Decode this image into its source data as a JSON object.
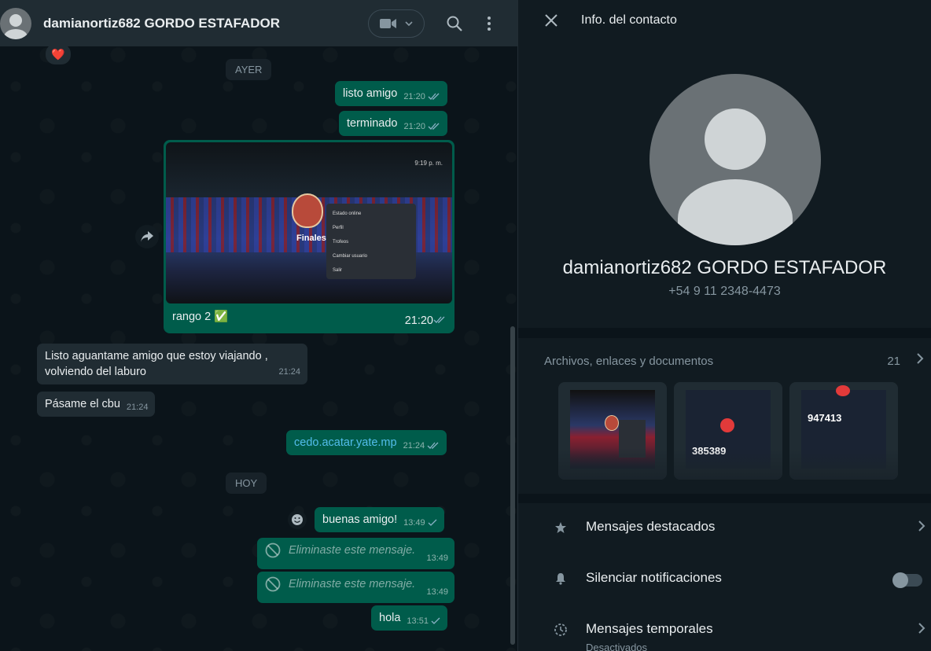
{
  "chat": {
    "title": "damianortiz682 GORDO ESTAFADOR",
    "reaction": "❤️",
    "day_yesterday": "AYER",
    "day_today": "HOY",
    "messages": [
      {
        "text": "listo amigo",
        "time": "21:20"
      },
      {
        "text": "terminado",
        "time": "21:20"
      },
      {
        "text": "rango 2 ✅",
        "time": "21:20"
      },
      {
        "text": "Listo aguantame amigo que estoy viajando , volviendo del laburo",
        "time": "21:24"
      },
      {
        "text": "Pásame el cbu",
        "time": "21:24"
      },
      {
        "text": "cedo.acatar.yate.mp",
        "time": "21:24"
      },
      {
        "text": "buenas amigo!",
        "time": "13:49"
      },
      {
        "text": "Eliminaste este mensaje.",
        "time": "13:49"
      },
      {
        "text": "Eliminaste este mensaje.",
        "time": "13:49"
      },
      {
        "text": "hola",
        "time": "13:51"
      }
    ],
    "photo": {
      "clock": "9:19 p. m.",
      "caption_word": "Finales",
      "menu": [
        "Estado online",
        "Perfil",
        "Trofeos",
        "Cambiar usuario",
        "Salir"
      ]
    }
  },
  "info": {
    "title": "Info. del contacto",
    "name": "damianortiz682 GORDO ESTAFADOR",
    "phone": "+54 9 11 2348-4473",
    "media_label": "Archivos, enlaces y documentos",
    "media_count": "21",
    "thumb_codes": [
      "385389",
      "947413"
    ],
    "options": [
      {
        "label": "Mensajes destacados"
      },
      {
        "label": "Silenciar notificaciones"
      },
      {
        "label": "Mensajes temporales",
        "sub": "Desactivados"
      }
    ]
  },
  "colors": {
    "outgoing": "#005c4b",
    "incoming": "#202c33",
    "panel": "#111b21",
    "link": "#53bdeb"
  }
}
